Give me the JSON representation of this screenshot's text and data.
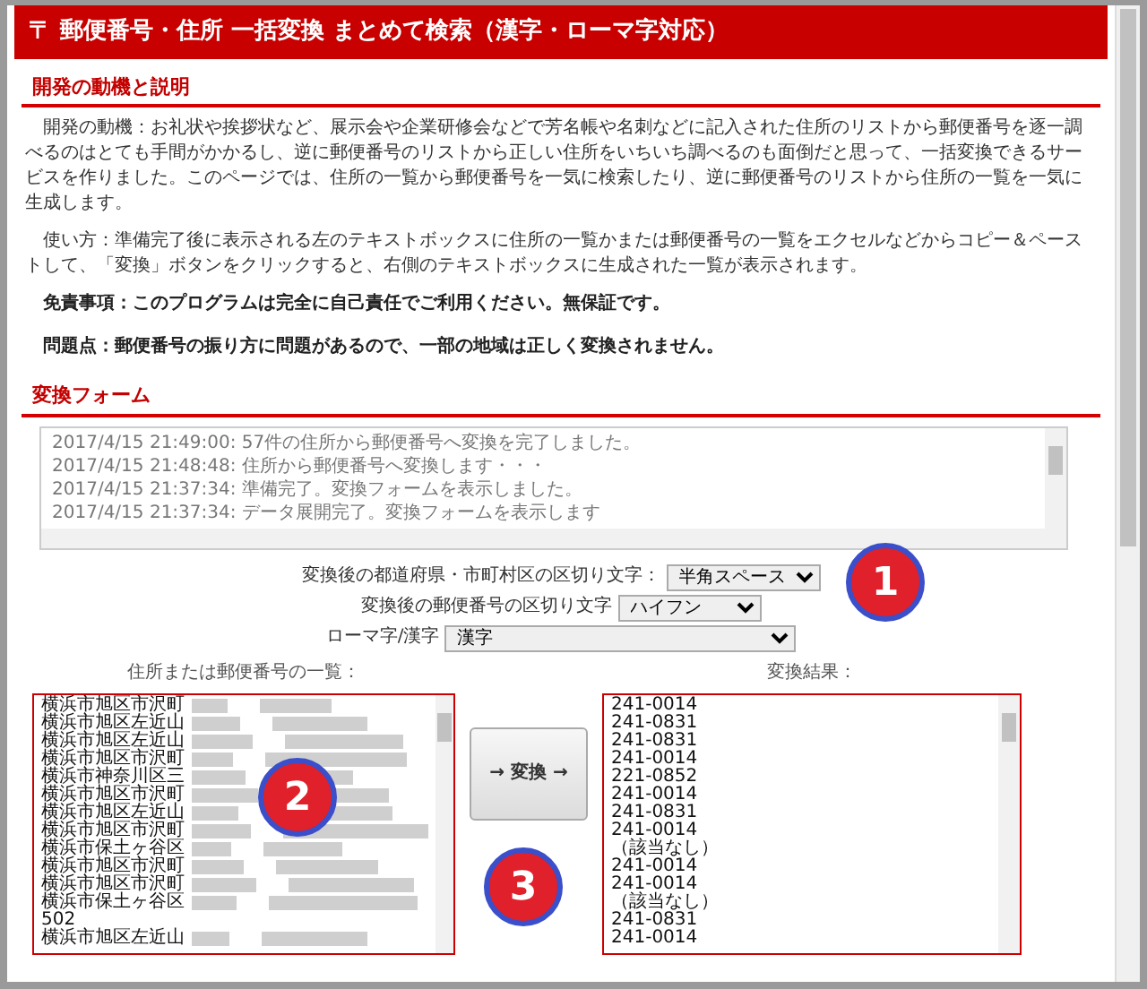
{
  "title": "〒 郵便番号・住所 一括変換 まとめて検索（漢字・ローマ字対応）",
  "sections": [
    {
      "heading": "開発の動機と説明",
      "paragraphs": [
        {
          "text": "開発の動機：お礼状や挨拶状など、展示会や企業研修会などで芳名帳や名刺などに記入された住所のリストから郵便番号を逐一調べるのはとても手間がかかるし、逆に郵便番号のリストから正しい住所をいちいち調べるのも面倒だと思って、一括変換できるサービスを作りました。このページでは、住所の一覧から郵便番号を一気に検索したり、逆に郵便番号のリストから住所の一覧を一気に生成します。",
          "bold": false
        },
        {
          "text": "使い方：準備完了後に表示される左のテキストボックスに住所の一覧かまたは郵便番号の一覧をエクセルなどからコピー＆ペーストして、「変換」ボタンをクリックすると、右側のテキストボックスに生成された一覧が表示されます。",
          "bold": false
        },
        {
          "text": "免責事項：このプログラムは完全に自己責任でご利用ください。無保証です。",
          "bold": true
        },
        {
          "text": "問題点：郵便番号の振り方に問題があるので、一部の地域は正しく変換されません。",
          "bold": true
        }
      ]
    },
    {
      "heading": "変換フォーム"
    }
  ],
  "log": [
    "2017/4/15 21:49:00: 57件の住所から郵便番号へ変換を完了しました。",
    "2017/4/15 21:48:48: 住所から郵便番号へ変換します・・・",
    "2017/4/15 21:37:34: 準備完了。変換フォームを表示しました。",
    "2017/4/15 21:37:34: データ展開完了。変換フォームを表示します"
  ],
  "options": [
    {
      "label": "変換後の都道府県・市町村区の区切り文字：",
      "value": "半角スペース"
    },
    {
      "label": "変換後の郵便番号の区切り文字",
      "value": "ハイフン"
    },
    {
      "label": "ローマ字/漢字",
      "value": "漢字"
    }
  ],
  "input": {
    "label": "住所または郵便番号の一覧：",
    "lines": [
      {
        "text": "横浜市旭区市沢町",
        "redacted": true
      },
      {
        "text": "横浜市旭区左近山",
        "redacted": true
      },
      {
        "text": "横浜市旭区左近山",
        "redacted": true
      },
      {
        "text": "横浜市旭区市沢町",
        "redacted": true
      },
      {
        "text": "横浜市神奈川区三",
        "redacted": true
      },
      {
        "text": "横浜市旭区市沢町",
        "redacted": true
      },
      {
        "text": "横浜市旭区左近山",
        "redacted": true
      },
      {
        "text": "横浜市旭区市沢町",
        "redacted": true
      },
      {
        "text": "横浜市保土ヶ谷区",
        "redacted": true
      },
      {
        "text": "横浜市旭区市沢町",
        "redacted": true
      },
      {
        "text": "横浜市旭区市沢町",
        "redacted": true
      },
      {
        "text": "横浜市保土ヶ谷区",
        "redacted": true
      },
      {
        "text": "502",
        "redacted": false
      },
      {
        "text": "横浜市旭区左近山",
        "redacted": true
      }
    ]
  },
  "convert_button": "→ 変換 →",
  "output": {
    "label": "変換結果：",
    "lines": [
      "241-0014",
      "241-0831",
      "241-0831",
      "241-0014",
      "221-0852",
      "241-0014",
      "241-0831",
      "241-0014",
      "（該当なし）",
      "241-0014",
      "241-0014",
      "（該当なし）",
      "241-0831",
      "241-0014"
    ]
  },
  "callouts": [
    "1",
    "2",
    "3"
  ]
}
